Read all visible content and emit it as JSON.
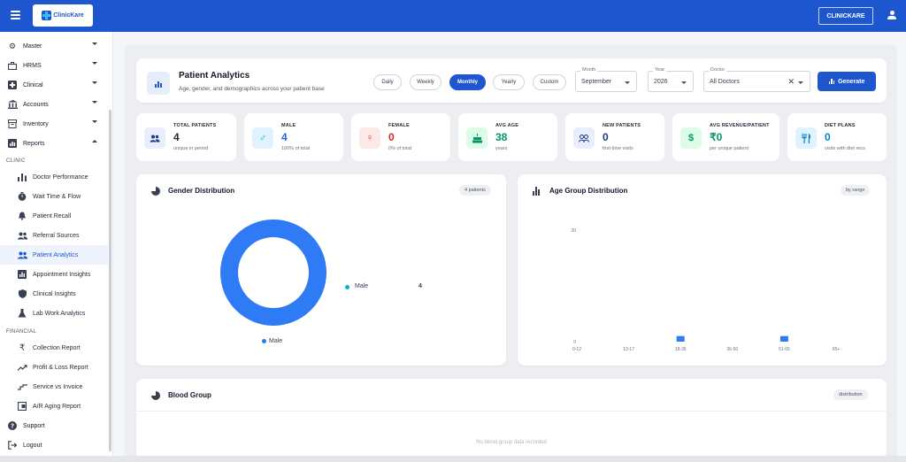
{
  "app": {
    "logo_text": "ClinicKare",
    "clinic_button": "CLINICKARE"
  },
  "sidebar": {
    "top_items": [
      {
        "label": "Master",
        "icon": "gear-icon"
      },
      {
        "label": "HRMS",
        "icon": "briefcase-icon"
      },
      {
        "label": "Clinical",
        "icon": "medical-cross-icon"
      },
      {
        "label": "Accounts",
        "icon": "bank-icon"
      },
      {
        "label": "Inventory",
        "icon": "box-icon"
      },
      {
        "label": "Reports",
        "icon": "report-icon"
      }
    ],
    "clinic_section": "CLINIC",
    "clinic_items": [
      {
        "label": "Doctor Performance",
        "icon": "bar-chart-icon"
      },
      {
        "label": "Wait Time & Flow",
        "icon": "timer-icon"
      },
      {
        "label": "Patient Recall",
        "icon": "bell-icon"
      },
      {
        "label": "Referral Sources",
        "icon": "people-icon"
      },
      {
        "label": "Patient Analytics",
        "icon": "people-icon"
      },
      {
        "label": "Appointment Insights",
        "icon": "chart-box-icon"
      },
      {
        "label": "Clinical Insights",
        "icon": "shield-icon"
      },
      {
        "label": "Lab Work Analytics",
        "icon": "flask-icon"
      }
    ],
    "financial_section": "FINANCIAL",
    "financial_items": [
      {
        "label": "Collection Report",
        "icon": "rupee-icon"
      },
      {
        "label": "Profit & Loss Report",
        "icon": "trend-icon"
      },
      {
        "label": "Service vs Invoice",
        "icon": "compare-icon"
      },
      {
        "label": "A/R Aging Report",
        "icon": "ledger-icon"
      }
    ],
    "support": "Support",
    "logout": "Logout"
  },
  "header": {
    "title": "Patient Analytics",
    "subtitle": "Age, gender, and demographics across your patient base",
    "periods": [
      "Daily",
      "Weekly",
      "Monthly",
      "Yearly",
      "Custom"
    ],
    "active_period": "Monthly",
    "month": {
      "label": "Month",
      "value": "September"
    },
    "year": {
      "label": "Year",
      "value": "2026"
    },
    "doctor": {
      "label": "Doctor",
      "value": "All Doctors"
    },
    "generate": "Generate"
  },
  "stats": [
    {
      "label": "TOTAL PATIENTS",
      "value": "4",
      "sub": "unique in period",
      "color": "#1e3a8a",
      "bg": "#e8eefb",
      "icon": "people-icon"
    },
    {
      "label": "MALE",
      "value": "4",
      "sub": "100% of total",
      "color": "#2563eb",
      "bg": "#e0f2fe",
      "icon": "male-icon"
    },
    {
      "label": "FEMALE",
      "value": "0",
      "sub": "0% of total",
      "color": "#dc2626",
      "bg": "#fde8e8",
      "icon": "female-icon"
    },
    {
      "label": "AVG AGE",
      "value": "38",
      "sub": "years",
      "color": "#059669",
      "bg": "#dcfce7",
      "icon": "cake-icon"
    },
    {
      "label": "NEW PATIENTS",
      "value": "0",
      "sub": "first-time visits",
      "color": "#1e3a8a",
      "bg": "#e8eefb",
      "icon": "new-people-icon"
    },
    {
      "label": "AVG REVENUE/PATIENT",
      "value": "₹0",
      "sub": "per unique patient",
      "color": "#059669",
      "bg": "#dcfce7",
      "icon": "rupee-icon"
    },
    {
      "label": "DIET PLANS",
      "value": "0",
      "sub": "visits with diet recs",
      "color": "#0284c7",
      "bg": "#e0f2fe",
      "icon": "utensils-icon"
    }
  ],
  "gender_panel": {
    "title": "Gender Distribution",
    "badge": "4 patients",
    "legend_bottom": "Male",
    "legend_right_label": "Male",
    "legend_right_value": "4",
    "color": "#2f7bf5",
    "legend_dot_color": "#06b6d4"
  },
  "age_panel": {
    "title": "Age Group Distribution",
    "badge": "by range"
  },
  "blood_panel": {
    "title": "Blood Group",
    "badge": "distribution",
    "empty": "No blood group data recorded"
  },
  "chart_data": {
    "type": "bar",
    "categories": [
      "0-12",
      "13-17",
      "18-35",
      "36-50",
      "51-65",
      "65+"
    ],
    "values": [
      0,
      0,
      1,
      0,
      1,
      0
    ],
    "ylim": [
      0,
      20
    ],
    "yticks": [
      "20",
      "0"
    ],
    "title": "Age Group Distribution",
    "bar_color": "#2f7bf5"
  }
}
